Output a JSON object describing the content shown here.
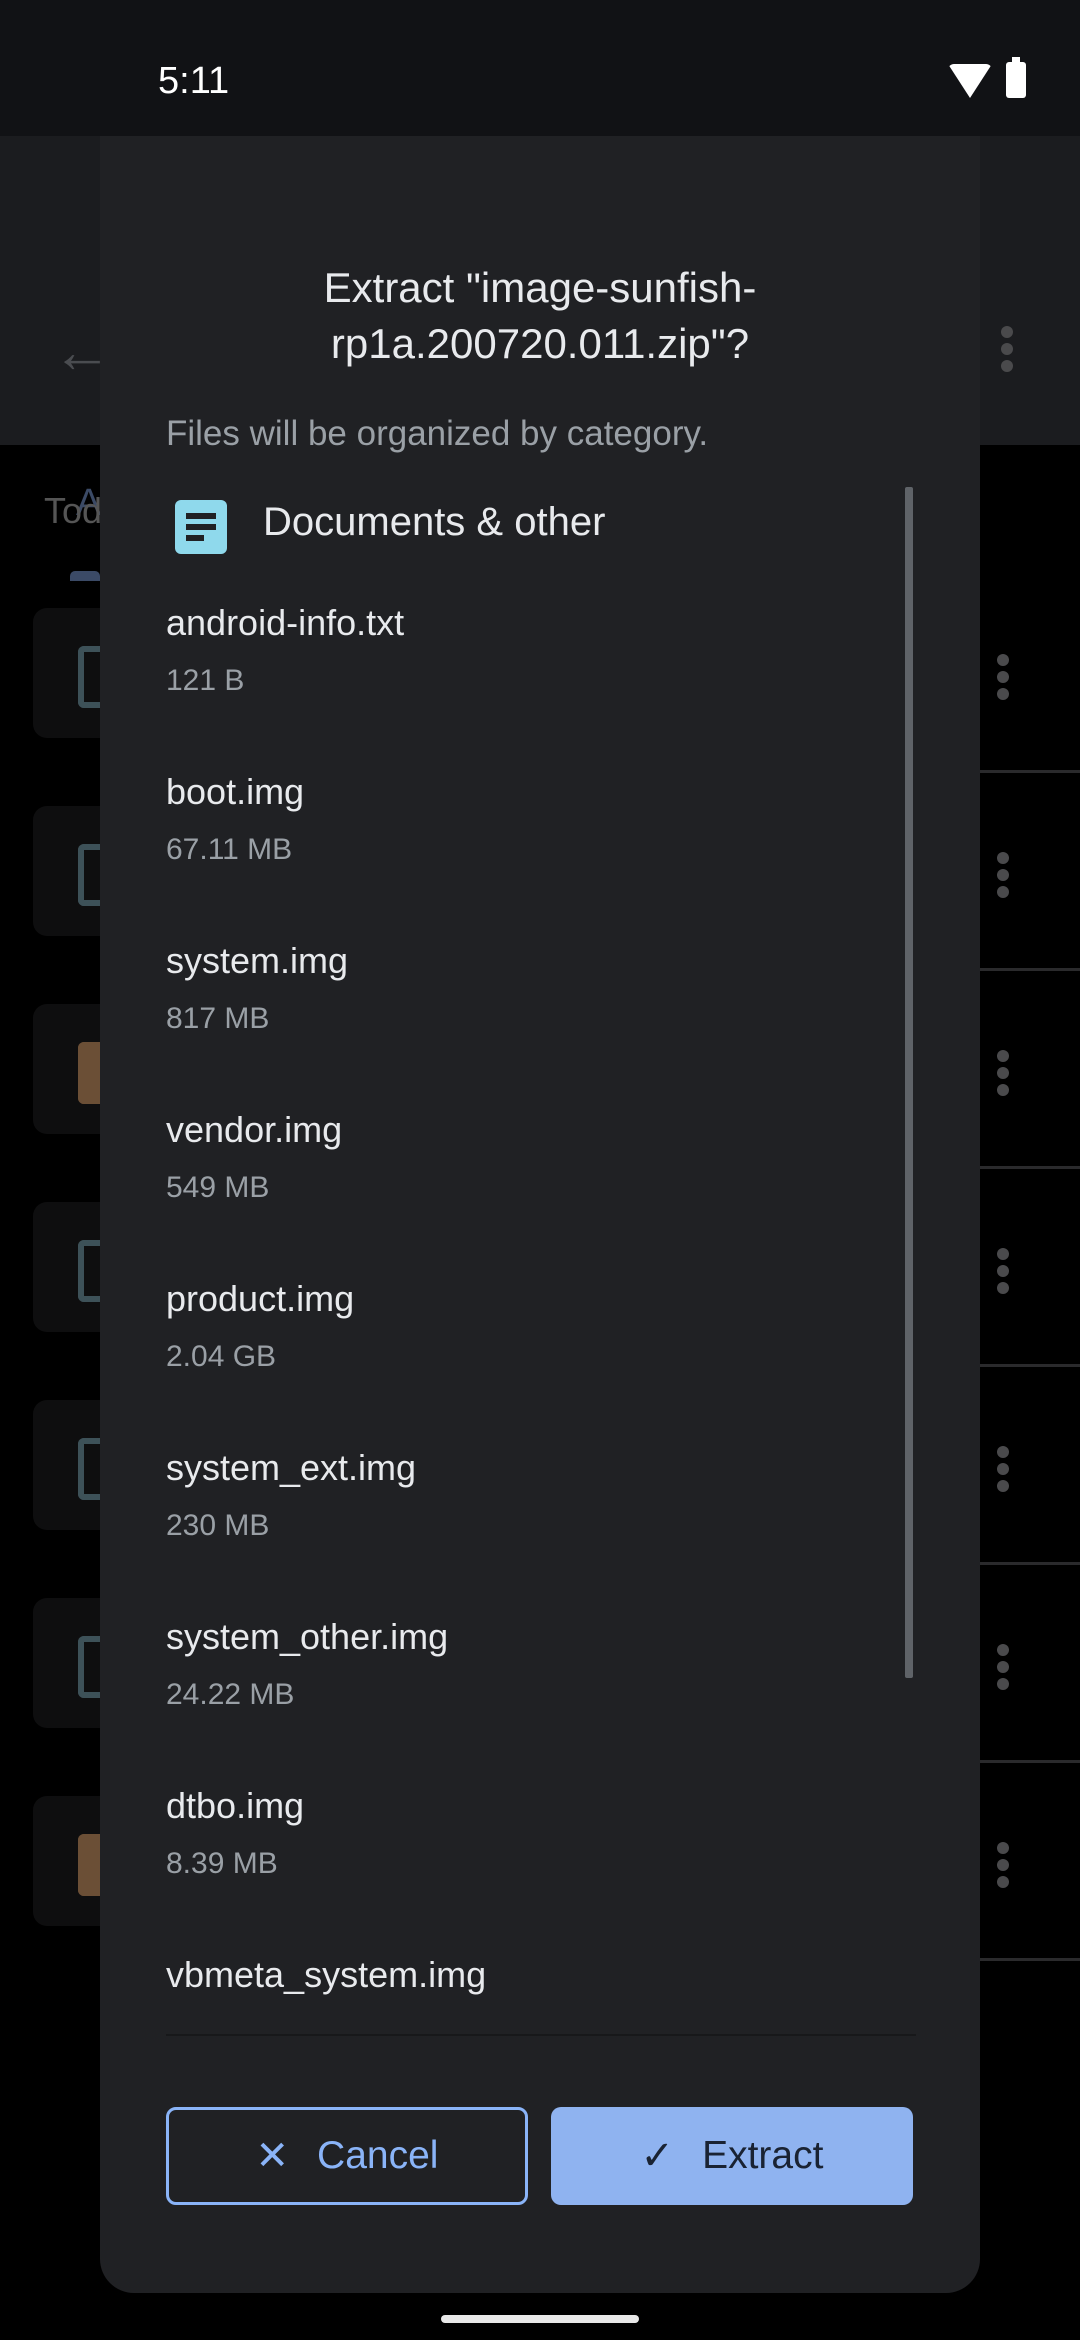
{
  "status_bar": {
    "time": "5:11",
    "icons": [
      "wifi-icon",
      "battery-icon"
    ]
  },
  "background": {
    "tab_partial": "A",
    "section_partial": "Tod",
    "rows": [
      {
        "icon": "document-icon"
      },
      {
        "icon": "document-icon"
      },
      {
        "icon": "zip-icon"
      },
      {
        "icon": "document-icon"
      },
      {
        "icon": "document-icon"
      },
      {
        "icon": "document-icon"
      },
      {
        "icon": "zip-icon"
      }
    ]
  },
  "dialog": {
    "title": "Extract \"image-sunfish-rp1a.200720.011.zip\"?",
    "subtitle": "Files will be organized by category.",
    "category": {
      "icon": "document-icon",
      "label": "Documents & other",
      "icon_color": "#8fd9ec"
    },
    "files": [
      {
        "name": "android-info.txt",
        "size": "121 B"
      },
      {
        "name": "boot.img",
        "size": "67.11 MB"
      },
      {
        "name": "system.img",
        "size": "817 MB"
      },
      {
        "name": "vendor.img",
        "size": "549 MB"
      },
      {
        "name": "product.img",
        "size": "2.04 GB"
      },
      {
        "name": "system_ext.img",
        "size": "230 MB"
      },
      {
        "name": "system_other.img",
        "size": "24.22 MB"
      },
      {
        "name": "dtbo.img",
        "size": "8.39 MB"
      },
      {
        "name": "vbmeta_system.img",
        "size": ""
      }
    ],
    "cancel_label": "Cancel",
    "extract_label": "Extract",
    "accent_color": "#8ab4f8"
  }
}
